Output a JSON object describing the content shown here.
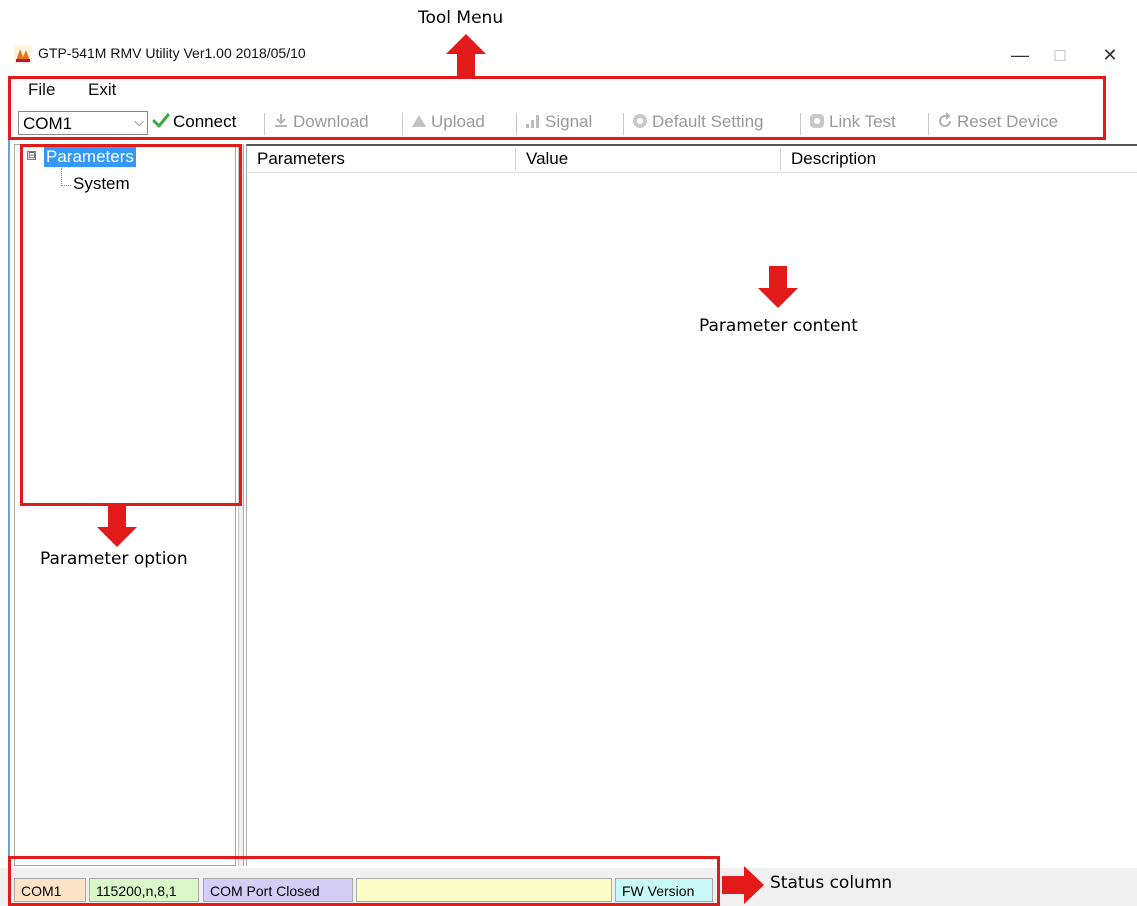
{
  "window": {
    "title": "GTP-541M RMV Utility Ver1.00 2018/05/10",
    "minimize_glyph": "—",
    "maximize_glyph": "□",
    "close_glyph": "✕"
  },
  "menu": {
    "items": [
      {
        "label": "File"
      },
      {
        "label": "Exit"
      }
    ]
  },
  "toolbar": {
    "port_select": {
      "value": "COM1",
      "arrow": "⌵"
    },
    "buttons": [
      {
        "label": "Connect",
        "icon": "checkmark-icon",
        "enabled": true
      },
      {
        "label": "Download",
        "icon": "download-icon",
        "enabled": false
      },
      {
        "label": "Upload",
        "icon": "upload-icon",
        "enabled": false
      },
      {
        "label": "Signal",
        "icon": "signal-bars-icon",
        "enabled": false
      },
      {
        "label": "Default Setting",
        "icon": "gear-icon",
        "enabled": false
      },
      {
        "label": "Link Test",
        "icon": "link-test-icon",
        "enabled": false
      },
      {
        "label": "Reset Device",
        "icon": "reset-icon",
        "enabled": false
      }
    ]
  },
  "tree": {
    "root": {
      "label": "Parameters",
      "toggle": "⊟"
    },
    "children": [
      {
        "label": "System"
      }
    ]
  },
  "table": {
    "columns": [
      {
        "label": "Parameters"
      },
      {
        "label": "Value"
      },
      {
        "label": "Description"
      }
    ]
  },
  "statusbar": {
    "segments": [
      {
        "text": "COM1",
        "color": "#fde3c8"
      },
      {
        "text": "115200,n,8,1",
        "color": "#d9f7c8"
      },
      {
        "text": "COM Port Closed",
        "color": "#d4cdf5"
      },
      {
        "text": "",
        "color": "#fdfdc8"
      },
      {
        "text": "FW Version",
        "color": "#c9f8f8"
      }
    ]
  },
  "annotations": {
    "tool_menu": "Tool Menu",
    "parameter_content": "Parameter content",
    "parameter_option": "Parameter option",
    "status_column": "Status column",
    "color": "#e21a1a"
  }
}
